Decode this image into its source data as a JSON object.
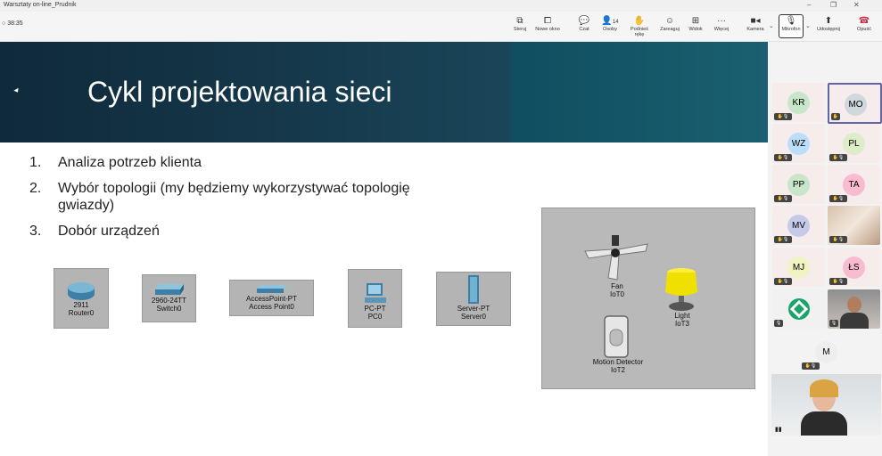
{
  "window": {
    "title": "Warsztaty on-line_Prudnik"
  },
  "toolbar": {
    "timer": "38:35",
    "buttons": [
      {
        "label": "Steruj",
        "icon": "control-icon"
      },
      {
        "label": "Nowe okno",
        "icon": "new-window-icon"
      },
      {
        "label": "Czat",
        "icon": "chat-icon"
      },
      {
        "label": "Osoby",
        "icon": "people-icon",
        "badge": "14"
      },
      {
        "label": "Podnieś rękę",
        "icon": "hand-icon"
      },
      {
        "label": "Zareaguj",
        "icon": "smile-icon"
      },
      {
        "label": "Widok",
        "icon": "grid-icon"
      },
      {
        "label": "Więcej",
        "icon": "more-icon"
      },
      {
        "label": "Kamera",
        "icon": "camera-icon"
      },
      {
        "label": "Mikrofon",
        "icon": "mic-icon"
      },
      {
        "label": "Udostępnij",
        "icon": "share-icon"
      },
      {
        "label": "Opuść",
        "icon": "hangup-icon"
      }
    ]
  },
  "slide": {
    "title": "Cykl projektowania sieci",
    "list": [
      {
        "num": "1.",
        "line1": "Analiza potrzeb klienta",
        "line2": ""
      },
      {
        "num": "2.",
        "line1": "Wybór topologii (my będziemy wykorzystywać topologię",
        "line2": "gwiazdy)"
      },
      {
        "num": "3.",
        "line1": "Dobór urządzeń",
        "line2": ""
      }
    ],
    "devices": [
      {
        "line1": "2911",
        "line2": "Router0"
      },
      {
        "line1": "2960-24TT",
        "line2": "Switch0"
      },
      {
        "line1": "AccessPoint-PT",
        "line2": "Access Point0"
      },
      {
        "line1": "PC-PT",
        "line2": "PC0"
      },
      {
        "line1": "Server-PT",
        "line2": "Server0"
      }
    ],
    "iot": [
      {
        "line1": "Fan",
        "line2": "IoT0"
      },
      {
        "line1": "Light",
        "line2": "IoT3"
      },
      {
        "line1": "Motion Detector",
        "line2": "IoT2"
      }
    ]
  },
  "participants": [
    {
      "initials": "KR",
      "color": "#c8e6c9"
    },
    {
      "initials": "MO",
      "color": "#cfd8dc"
    },
    {
      "initials": "WZ",
      "color": "#bbdefb"
    },
    {
      "initials": "PL",
      "color": "#dcedc8"
    },
    {
      "initials": "PP",
      "color": "#c8e6c9"
    },
    {
      "initials": "TA",
      "color": "#f8bbd0"
    },
    {
      "initials": "MV",
      "color": "#c5cae9"
    },
    {
      "initials": "MJ",
      "color": "#f0f4c3"
    },
    {
      "initials": "ŁS",
      "color": "#f8bbd0"
    },
    {
      "initials": "M",
      "color": "#eeeeee"
    }
  ]
}
